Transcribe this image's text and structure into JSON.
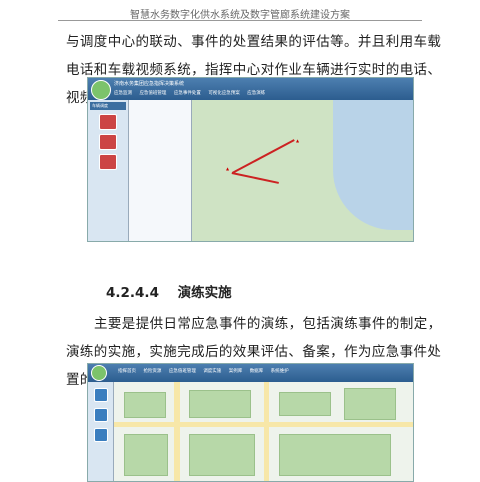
{
  "header": {
    "title": "智慧水务数字化供水系统及数字管廊系统建设方案"
  },
  "para1": "与调度中心的联动、事件的处置结果的评估等。并且利用车载电话和车载视频系统，指挥中心对作业车辆进行实时的电话、视频通讯调度。",
  "section": {
    "number": "4.2.4.4",
    "title": "演练实施"
  },
  "para2": "主要是提供日常应急事件的演练，包括演练事件的制定，演练的实施，实施完成后的效果评估、备案，作为应急事件处置的参考。",
  "screenshot1": {
    "app_title": "济南水务集团应急指挥决策系统",
    "menu": [
      "应急监测",
      "应急值班管理",
      "应急事件处置",
      "可视化应急预案",
      "应急演练"
    ],
    "panel_header": "车辆调度"
  },
  "screenshot2": {
    "menu": [
      "指挥首页",
      "抢险资源",
      "应急值班管理",
      "调度实施",
      "案例库",
      "数据库",
      "系统维护"
    ]
  }
}
